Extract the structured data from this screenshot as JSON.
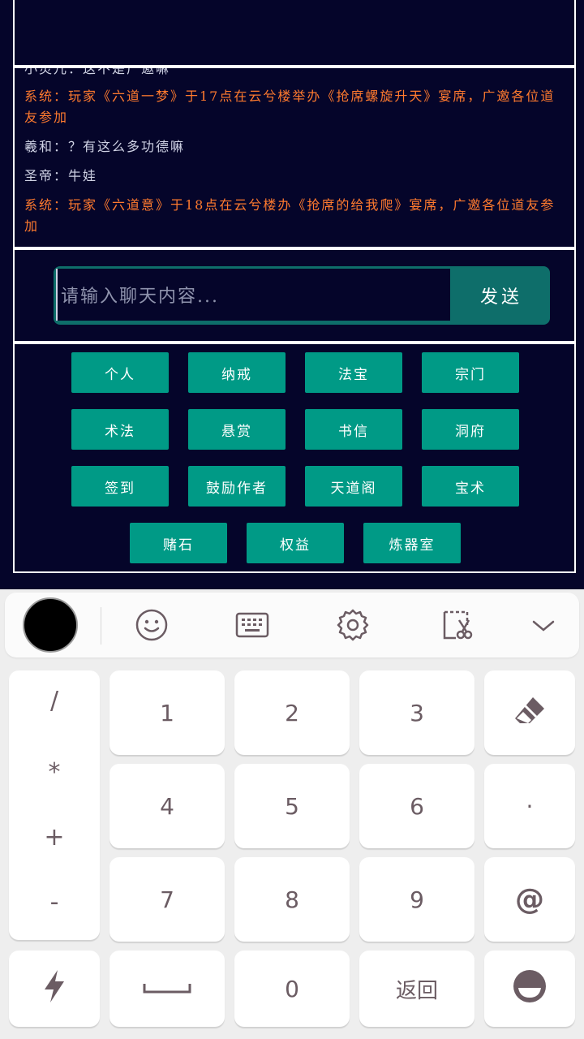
{
  "chat": {
    "cut_line": "小灵儿：这不是广邀嘛",
    "messages": [
      {
        "type": "sys",
        "text": "系统：玩家《六道一梦》于17点在云兮楼举办《抢席螺旋升天》宴席，广邀各位道友参加"
      },
      {
        "type": "user",
        "text": "羲和：？有这么多功德嘛"
      },
      {
        "type": "user",
        "text": "圣帝：牛娃"
      },
      {
        "type": "sys",
        "text": "系统：玩家《六道意》于18点在云兮楼办《抢席的给我爬》宴席，广邀各位道友参加"
      }
    ]
  },
  "input": {
    "placeholder": "请输入聊天内容...",
    "send_label": "发送"
  },
  "menu": {
    "buttons": [
      "个人",
      "纳戒",
      "法宝",
      "宗门",
      "术法",
      "悬赏",
      "书信",
      "洞府",
      "签到",
      "鼓励作者",
      "天道阁",
      "宝术",
      "赌石",
      "权益",
      "炼器室"
    ]
  },
  "keyboard": {
    "symbols": [
      "/",
      "*",
      "+",
      "-"
    ],
    "digits": [
      "1",
      "2",
      "3",
      "4",
      "5",
      "6",
      "7",
      "8",
      "9",
      "0"
    ],
    "dot_label": "·",
    "at_label": "@",
    "back_label": "返回",
    "icons": {
      "toolbar": [
        "emoji-icon",
        "keyboard-icon",
        "settings-icon",
        "clipboard-icon",
        "collapse-icon"
      ],
      "delete": "eraser-icon",
      "quick": "lightning-icon",
      "space": "space-icon",
      "emoji": "emoji-face-icon"
    }
  },
  "colors": {
    "background": "#05052a",
    "system_text": "#ff7a2e",
    "user_text": "#cfd2e4",
    "button": "#009a86",
    "send_button": "#0e6e6a"
  }
}
